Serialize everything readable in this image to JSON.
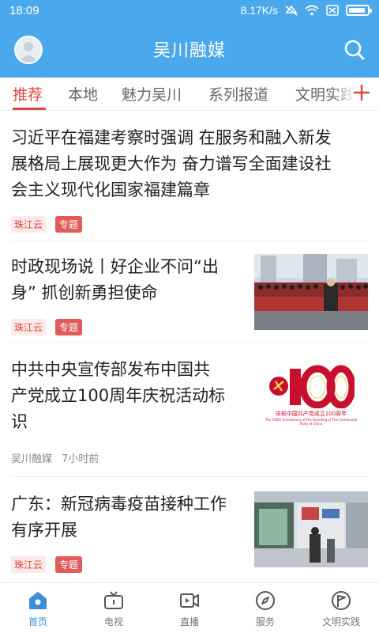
{
  "status_bar": {
    "time": "18:09",
    "network_speed": "8.17K/s"
  },
  "app_bar": {
    "title": "吴川融媒",
    "avatar_icon": "avatar-icon",
    "search_icon": "search-icon"
  },
  "tabs": [
    {
      "label": "推荐",
      "active": true
    },
    {
      "label": "本地",
      "active": false
    },
    {
      "label": "魅力吴川",
      "active": false
    },
    {
      "label": "系列报道",
      "active": false
    },
    {
      "label": "文明实践",
      "active": false
    }
  ],
  "news": [
    {
      "title_lines": [
        "习近平在福建考察时强调 在服务和融入新发",
        "展格局上展现更大作为 奋力谱写全面建设社",
        "会主义现代化国家福建篇章"
      ],
      "source": "珠江云",
      "badge": "专题"
    },
    {
      "title_lines": [
        "时政现场说丨好企业不问“出",
        "身” 抓创新勇担使命"
      ],
      "source": "珠江云",
      "badge": "专题"
    },
    {
      "title_lines": [
        "中共中央宣传部发布中国共",
        "产党成立100周年庆祝活动标",
        "识"
      ],
      "source": "吴川融媒",
      "time": "7小时前",
      "logo": {
        "number": "100",
        "caption": "庆祝中国共产党成立100周年",
        "caption_en": "The 100th Anniversary of the Founding of The Communist Party of China"
      }
    },
    {
      "title_lines": [
        "广东：新冠病毒疫苗接种工作",
        "有序开展"
      ],
      "source": "珠江云",
      "badge": "专题"
    }
  ],
  "bottom_nav": [
    {
      "label": "首页",
      "icon": "home-icon",
      "active": true
    },
    {
      "label": "电视",
      "icon": "tv-icon",
      "active": false
    },
    {
      "label": "直播",
      "icon": "live-icon",
      "active": false
    },
    {
      "label": "服务",
      "icon": "compass-icon",
      "active": false
    },
    {
      "label": "文明实践",
      "icon": "flag-icon",
      "active": false
    }
  ],
  "colors": {
    "primary": "#4aa8ec",
    "accent": "#d9483b",
    "nav_active": "#3a8fd9"
  }
}
